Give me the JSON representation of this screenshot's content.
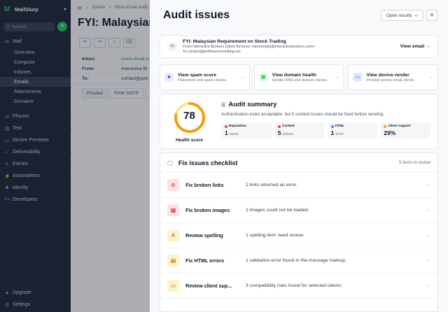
{
  "sidebar": {
    "brand": "MailSlurp",
    "search_placeholder": "Search...",
    "mail_label": "Mail",
    "mail_items": [
      "Overview",
      "Compose",
      "Inboxes",
      "Emails",
      "Attachments",
      "Domains"
    ],
    "groups": [
      {
        "label": "Phones",
        "icon": "phone-icon"
      },
      {
        "label": "Test",
        "icon": "test-icon"
      },
      {
        "label": "Device Previews",
        "icon": "device-icon"
      },
      {
        "label": "Deliverability",
        "icon": "deliverability-icon"
      },
      {
        "label": "Extract",
        "icon": "extract-icon"
      },
      {
        "label": "Automations",
        "icon": "automation-icon"
      },
      {
        "label": "Identity",
        "icon": "identity-icon"
      },
      {
        "label": "Developers",
        "icon": "developers-icon"
      }
    ],
    "bottom": [
      "Upgrade",
      "Settings"
    ]
  },
  "main": {
    "breadcrumb_emails": "Emails",
    "breadcrumb_current": "Mock-Email-Audit",
    "title": "FYI: Malaysian",
    "meta": [
      {
        "key": "Inbox:",
        "value": "mock-email-a"
      },
      {
        "key": "From:",
        "value": "Interactive Br"
      },
      {
        "key": "To:",
        "value": "contact@pett"
      }
    ],
    "tabs": [
      "Preview",
      "RAW SMTP",
      "Hea"
    ]
  },
  "drawer": {
    "title": "Audit issues",
    "open_results": "Open results",
    "email": {
      "subject": "FYI: Malaysian Requirement on Stock Trading",
      "from": "From Interactive Brokers Client Services <donotreply@interactivebrokers.com>",
      "to": "To contact@pettmanconsulting.net",
      "view_label": "View email"
    },
    "actions": [
      {
        "title": "View spam score",
        "desc": "Placement and spam checks."
      },
      {
        "title": "View domain health",
        "desc": "Sender DNS and domain checks."
      },
      {
        "title": "View device render",
        "desc": "Preview across email clients."
      }
    ],
    "summary": {
      "score": 78,
      "score_label": "Health score",
      "title": "Audit summary",
      "text": "Authentication looks acceptable, but 5 content issues should be fixed before sending.",
      "stats": [
        {
          "label": "Reputation",
          "value": "1",
          "unit": "issue",
          "color": "#ef4444"
        },
        {
          "label": "Content",
          "value": "5",
          "unit": "issues",
          "color": "#ef4444"
        },
        {
          "label": "HTML",
          "value": "1",
          "unit": "error",
          "color": "#3b82f6"
        },
        {
          "label": "Client support",
          "value": "29%",
          "unit": "",
          "color": "#f59e0b"
        }
      ]
    },
    "checklist": {
      "title": "Fix issues checklist",
      "count": "5 items to review",
      "items": [
        {
          "title": "Fix broken links",
          "desc": "2 links returned an error."
        },
        {
          "title": "Fix broken images",
          "desc": "2 images could not be loaded."
        },
        {
          "title": "Review spelling",
          "desc": "1 spelling item need review."
        },
        {
          "title": "Fix HTML errors",
          "desc": "1 validation error found in the message markup."
        },
        {
          "title": "Review client sup...",
          "desc": "3 compatibility risks found for selected clients."
        }
      ]
    }
  }
}
